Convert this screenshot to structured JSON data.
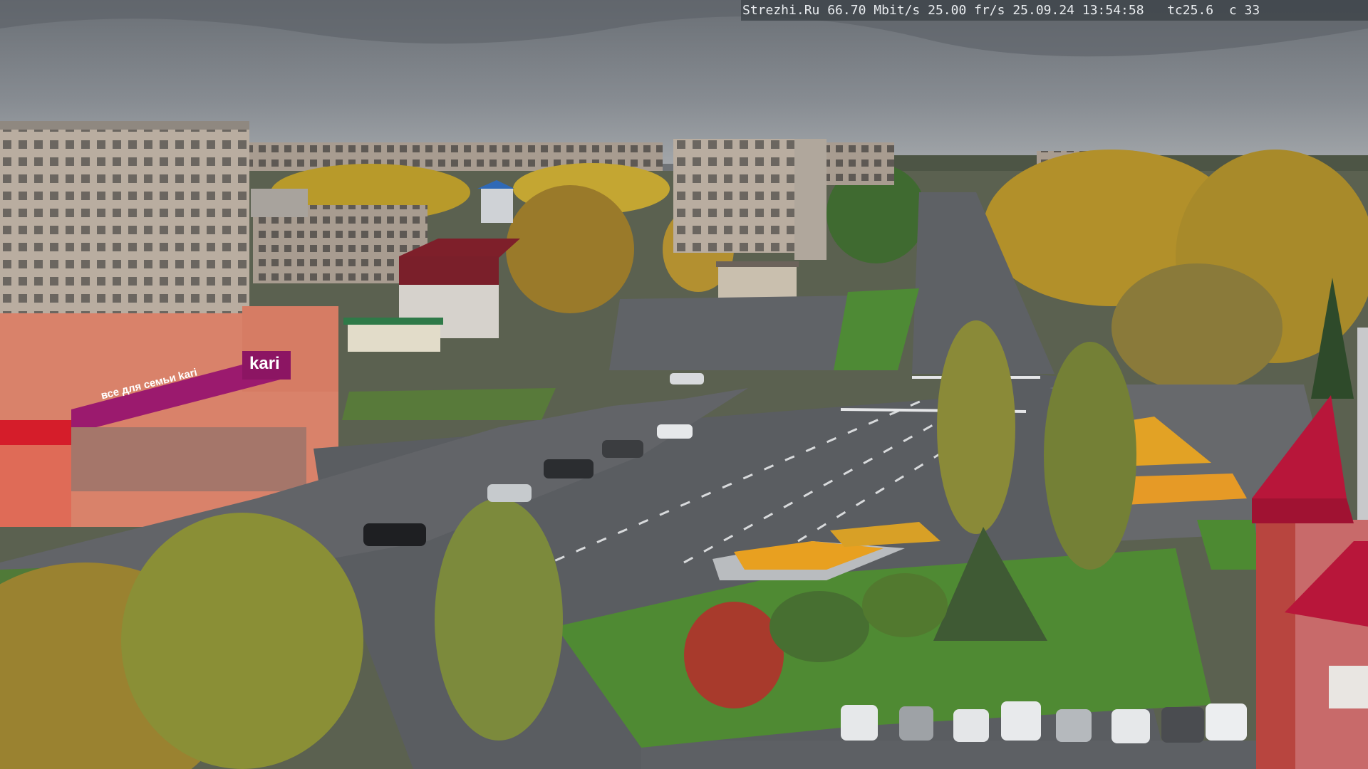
{
  "overlay": {
    "site": "Strezhi.Ru",
    "bitrate": "66.70 Mbit/s",
    "framerate": "25.00 fr/s",
    "date": "25.09.24",
    "time": "13:54:58",
    "temp": "tc25.6",
    "extra": "c 33"
  },
  "store_signs": {
    "kari_logo": "kari",
    "kari_banner": "все для семьи kari"
  },
  "colors": {
    "sky": "#7b8086",
    "asphalt": "#595c60",
    "grass": "#4f7a35",
    "kari_magenta": "#9b1a6e",
    "roof_red": "#b8163a"
  }
}
